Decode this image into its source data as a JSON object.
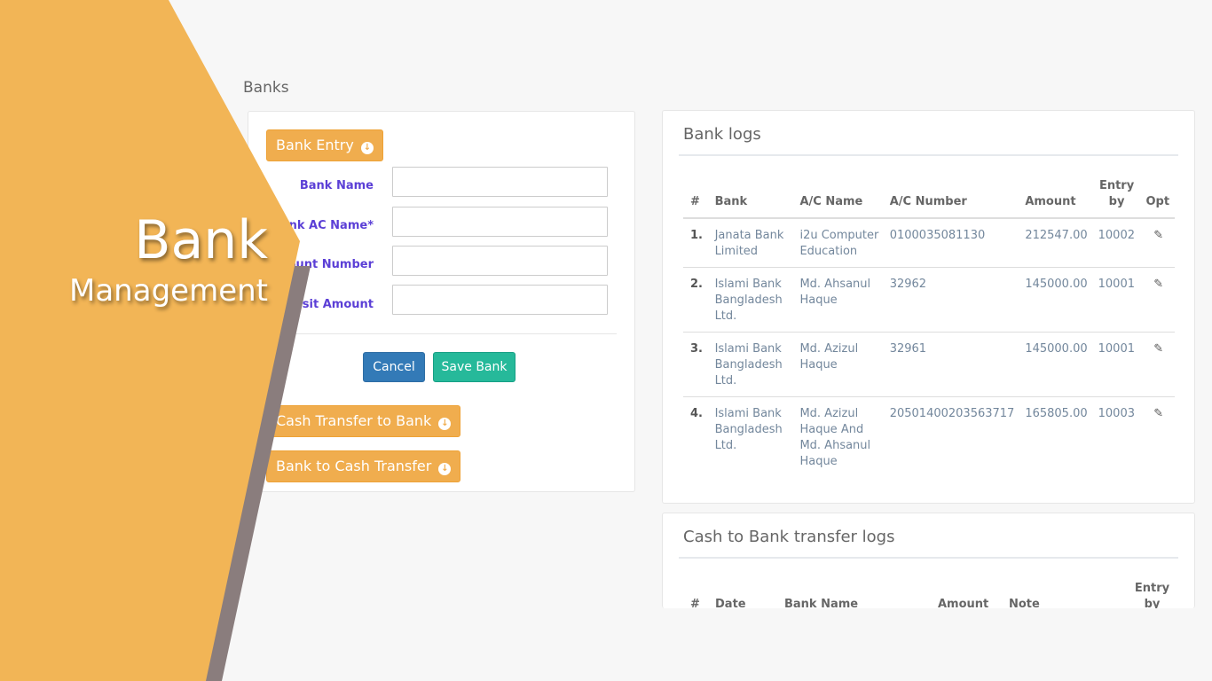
{
  "page": {
    "title": "Banks"
  },
  "brand": {
    "title": "Bank",
    "subtitle": "Management"
  },
  "form": {
    "bank_entry_label": "Bank Entry",
    "fields": [
      {
        "label": "Bank Name",
        "value": ""
      },
      {
        "label": "Bank AC Name*",
        "value": ""
      },
      {
        "label": "Account Number",
        "value": ""
      },
      {
        "label": "Deposit Amount",
        "value": ""
      }
    ],
    "cancel_label": "Cancel",
    "save_label": "Save Bank",
    "cash_to_bank_label": "Cash Transfer to Bank",
    "bank_to_cash_label": "Bank to Cash Transfer"
  },
  "bank_logs": {
    "title": "Bank logs",
    "columns": [
      "#",
      "Bank",
      "A/C Name",
      "A/C Number",
      "Amount",
      "Entry by",
      "Opt"
    ],
    "rows": [
      {
        "num": "1.",
        "bank": "Janata Bank Limited",
        "ac_name": "i2u Computer Education",
        "ac_number": "0100035081130",
        "amount": "212547.00",
        "entry_by": "10002"
      },
      {
        "num": "2.",
        "bank": "Islami Bank Bangladesh Ltd.",
        "ac_name": "Md. Ahsanul Haque",
        "ac_number": "32962",
        "amount": "145000.00",
        "entry_by": "10001"
      },
      {
        "num": "3.",
        "bank": "Islami Bank Bangladesh Ltd.",
        "ac_name": "Md. Azizul Haque",
        "ac_number": "32961",
        "amount": "145000.00",
        "entry_by": "10001"
      },
      {
        "num": "4.",
        "bank": "Islami Bank Bangladesh Ltd.",
        "ac_name": "Md. Azizul Haque And Md. Ahsanul Haque",
        "ac_number": "20501400203563717",
        "amount": "165805.00",
        "entry_by": "10003"
      }
    ]
  },
  "cash_logs": {
    "title": "Cash to Bank transfer logs",
    "columns": [
      "#",
      "Date",
      "Bank Name",
      "Amount",
      "Note",
      "Entry by"
    ]
  },
  "colors": {
    "accent": "#f0ad4e",
    "brand_shape": "#f2b556",
    "primary": "#337ab7",
    "success": "#26b99a",
    "label": "#5b3fd6"
  },
  "icons": {
    "dropdown": "circle-arrow-down-icon",
    "edit": "edit-icon"
  }
}
